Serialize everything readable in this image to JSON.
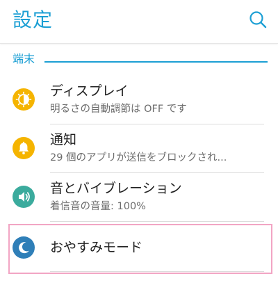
{
  "app_bar": {
    "title": "設定",
    "search_icon": "search-icon"
  },
  "section": {
    "label": "端末"
  },
  "items": [
    {
      "title": "ディスプレイ",
      "subtitle": "明るさの自動調節は OFF です",
      "icon": "brightness-icon",
      "icon_color": "#f5b400"
    },
    {
      "title": "通知",
      "subtitle": "29 個のアプリが送信をブロックされ...",
      "icon": "bell-icon",
      "icon_color": "#f5b400"
    },
    {
      "title": "音とバイブレーション",
      "subtitle": "着信音の音量: 100%",
      "icon": "speaker-icon",
      "icon_color": "#3bab9d"
    },
    {
      "title": "おやすみモード",
      "subtitle": "",
      "icon": "moon-icon",
      "icon_color": "#2f7fb8"
    }
  ],
  "colors": {
    "accent": "#1c9fd4",
    "highlight": "#f2a5c4"
  }
}
